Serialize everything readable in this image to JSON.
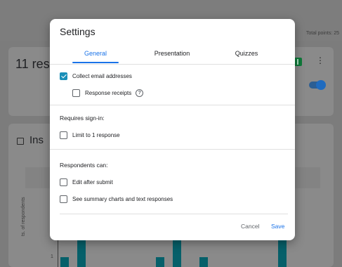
{
  "background": {
    "total_points": "Total points: 25",
    "card1_title": "11 res",
    "card2_title": "Ins",
    "chart_axis_title": "ts. of respondents",
    "chart_tick": "1"
  },
  "dialog": {
    "title": "Settings",
    "tabs": [
      {
        "label": "General",
        "active": true
      },
      {
        "label": "Presentation",
        "active": false
      },
      {
        "label": "Quizzes",
        "active": false
      }
    ],
    "options": {
      "collect_email": {
        "label": "Collect email addresses",
        "checked": true
      },
      "response_receipts": {
        "label": "Response receipts",
        "checked": false
      }
    },
    "requires_signin": {
      "heading": "Requires sign-in:",
      "limit_one": {
        "label": "Limit to 1 response",
        "checked": false
      }
    },
    "respondents_can": {
      "heading": "Respondents can:",
      "edit_after_submit": {
        "label": "Edit after submit",
        "checked": false
      },
      "see_summary": {
        "label": "See summary charts and text responses",
        "checked": false
      }
    },
    "footer": {
      "cancel_label": "Cancel",
      "save_label": "Save"
    }
  },
  "colors": {
    "accent": "#1a73e8",
    "checkbox_checked": "#1a8fb8",
    "overlay": "#7c7c7c",
    "chart_bar": "#06606a"
  }
}
